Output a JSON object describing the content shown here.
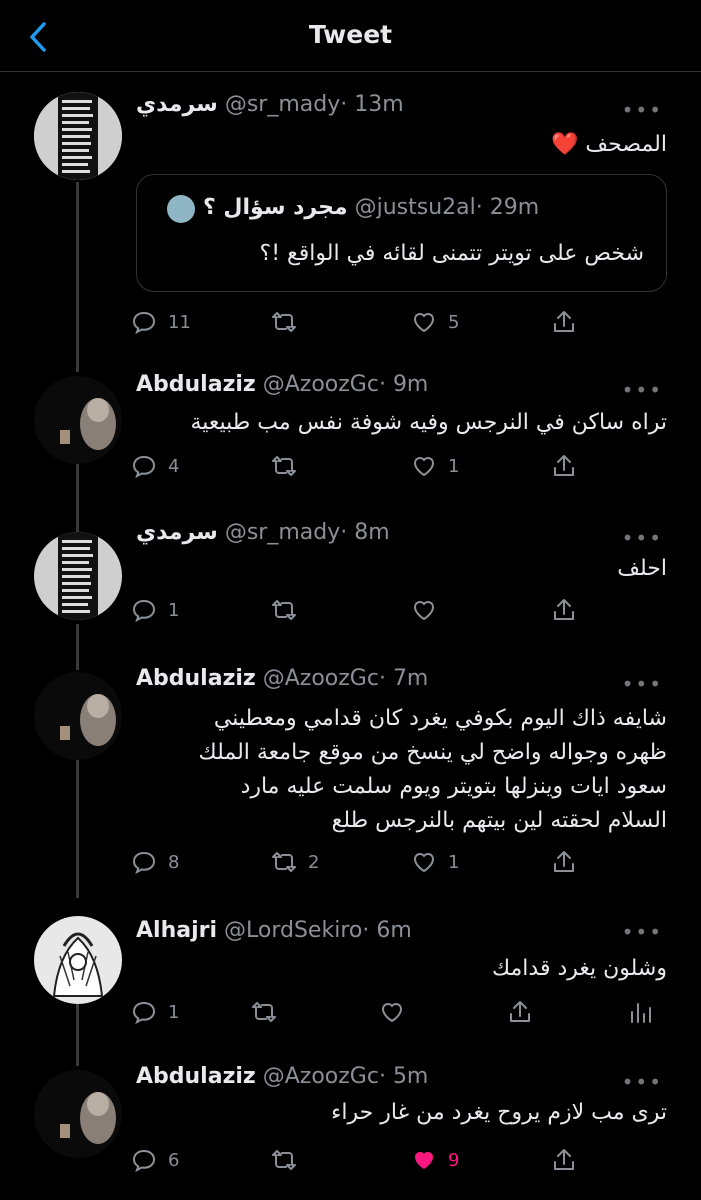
{
  "header": {
    "title": "Tweet"
  },
  "tweets": [
    {
      "name": "سرمدي",
      "handle": "@sr_mady",
      "time": "· 13m",
      "more": "•••",
      "text": [
        "المصحف ❤️"
      ],
      "quote": {
        "name": "مجرد سؤال ؟",
        "handle": "@justsu2al",
        "time": "· 29m",
        "text": "شخص على تويتر تتمنى لقائه في الواقع !؟"
      },
      "replies": "11",
      "retweets": "",
      "likes": "5"
    },
    {
      "name": "Abdulaziz",
      "handle": "@AzoozGc",
      "time": "· 9m",
      "more": "•••",
      "text": [
        "تراه ساكن في النرجس وفيه شوفة نفس مب طبيعية"
      ],
      "replies": "4",
      "retweets": "",
      "likes": "1"
    },
    {
      "name": "سرمدي",
      "handle": "@sr_mady",
      "time": "· 8m",
      "more": "•••",
      "text": [
        "احلف"
      ],
      "replies": "1",
      "retweets": "",
      "likes": ""
    },
    {
      "name": "Abdulaziz",
      "handle": "@AzoozGc",
      "time": "· 7m",
      "more": "•••",
      "text": [
        "شايفه ذاك اليوم بكوفي يغرد كان قدامي ومعطيني",
        "ظهره وجواله واضح لي ينسخ من موقع جامعة الملك",
        "سعود ايات وينزلها بتويتر ويوم سلمت عليه مارد",
        "السلام لحقته لين بيتهم بالنرجس طلع"
      ],
      "replies": "8",
      "retweets": "2",
      "likes": "1"
    },
    {
      "name": "Alhajri",
      "handle": "@LordSekiro",
      "time": "· 6m",
      "more": "•••",
      "text": [
        "وشلون يغرد قدامك"
      ],
      "replies": "1",
      "retweets": "",
      "likes": ""
    },
    {
      "name": "Abdulaziz",
      "handle": "@AzoozGc",
      "time": "· 5m",
      "more": "•••",
      "text": [
        "ترى مب لازم يروح يغرد من غار حراء"
      ],
      "replies": "6",
      "retweets": "",
      "likes": "9",
      "liked": true
    }
  ],
  "colors": {
    "background": "#000000",
    "text": "#e7e9ea",
    "muted": "#8b9096",
    "accent": "#1d9bf0",
    "like": "#f91880"
  }
}
